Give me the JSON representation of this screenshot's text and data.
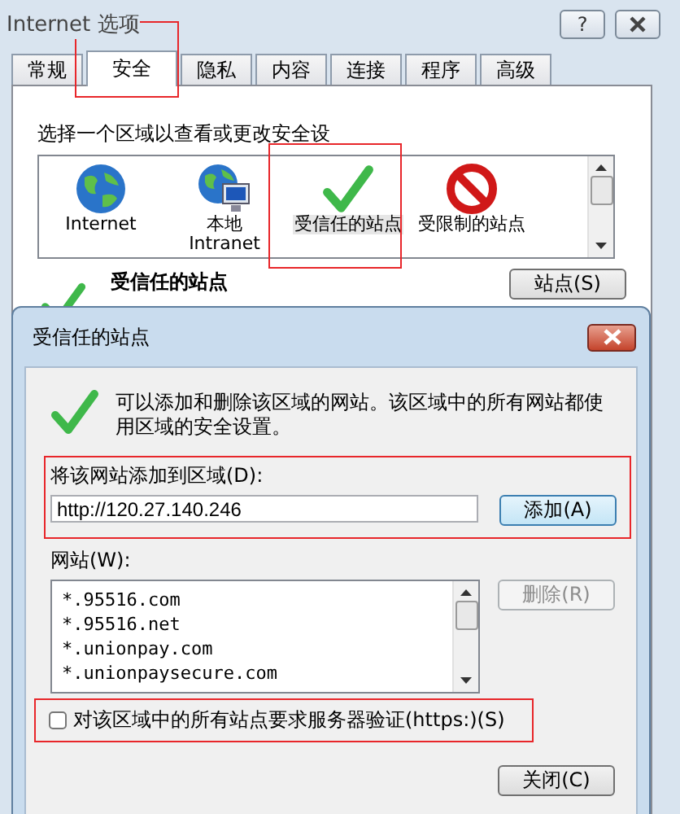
{
  "window": {
    "title": "Internet 选项",
    "help_button": "?"
  },
  "tabs": [
    {
      "label": "常规",
      "selected": false
    },
    {
      "label": "安全",
      "selected": true
    },
    {
      "label": "隐私",
      "selected": false
    },
    {
      "label": "内容",
      "selected": false
    },
    {
      "label": "连接",
      "selected": false
    },
    {
      "label": "程序",
      "selected": false
    },
    {
      "label": "高级",
      "selected": false
    }
  ],
  "zone_prompt": "选择一个区域以查看或更改安全设",
  "zones": [
    {
      "label": "Internet",
      "kind": "globe",
      "selected": false
    },
    {
      "label": "本地 Intranet",
      "kind": "intranet",
      "selected": false
    },
    {
      "label": "受信任的站点",
      "kind": "trusted",
      "selected": true
    },
    {
      "label": "受限制的站点",
      "kind": "restricted",
      "selected": false
    }
  ],
  "zone_details": {
    "title": "受信任的站点",
    "sites_button": "站点(S)"
  },
  "dialog": {
    "title": "受信任的站点",
    "description": "可以添加和删除该区域的网站。该区域中的所有网站都使用区域的安全设置。",
    "add_label": "将该网站添加到区域(D):",
    "url": {
      "value": "http://120.27.140.246"
    },
    "add_button": "添加(A)",
    "sites_label": "网站(W):",
    "sites": [
      "*.95516.com",
      "*.95516.net",
      "*.unionpay.com",
      "*.unionpaysecure.com"
    ],
    "remove_button": {
      "label": "删除(R)",
      "disabled": true
    },
    "require_https": {
      "label": "对该区域中的所有站点要求服务器验证(https:)(S)",
      "checked": false
    },
    "close_button": "关闭(C)"
  }
}
